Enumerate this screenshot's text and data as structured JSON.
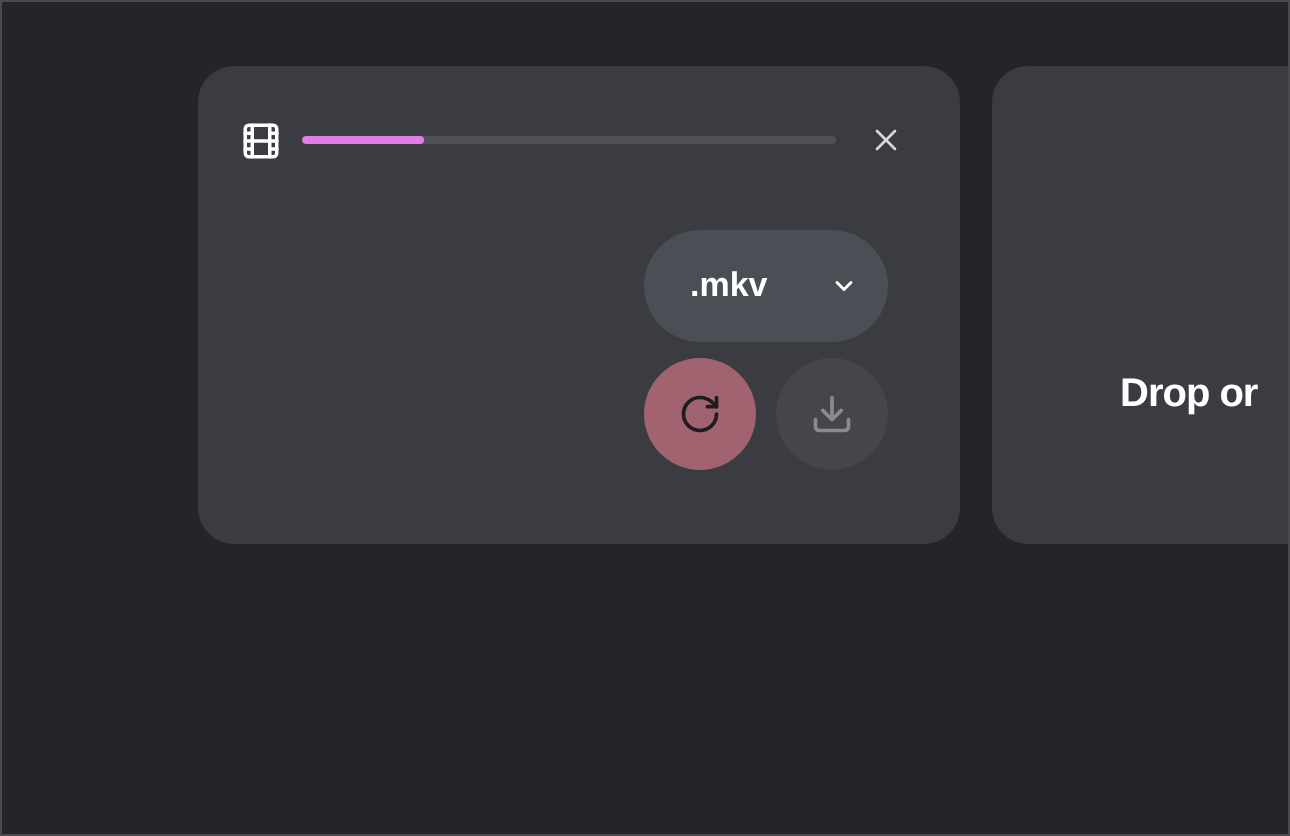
{
  "file_card": {
    "progress": {
      "level": 0.23
    },
    "format_select": {
      "value": ".mkv"
    },
    "convert_button": {
      "disabled": false
    },
    "download_button": {
      "disabled": true
    }
  },
  "drop_card": {
    "text": "Drop or"
  }
}
